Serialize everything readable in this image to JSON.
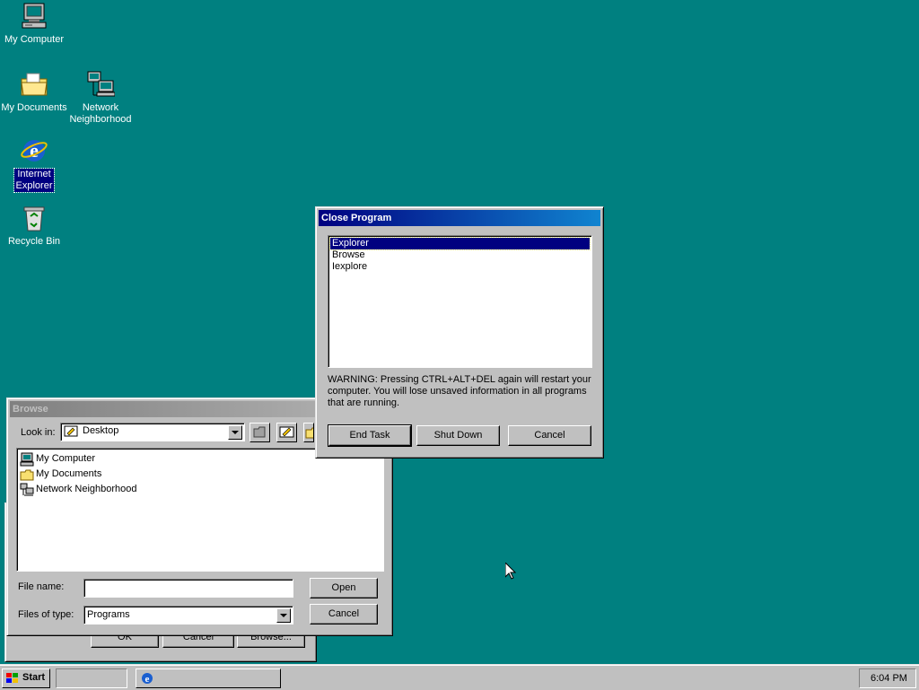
{
  "desktop": {
    "icons": [
      {
        "label": "My Computer",
        "icon": "my-computer-icon"
      },
      {
        "label": "My Documents",
        "icon": "my-documents-icon"
      },
      {
        "label": "Network Neighborhood",
        "icon": "network-neighborhood-icon"
      },
      {
        "label": "Internet Explorer",
        "icon": "internet-explorer-icon",
        "selected": true
      },
      {
        "label": "Recycle Bin",
        "icon": "recycle-bin-icon"
      }
    ],
    "background_color": "#008080"
  },
  "back_window": {
    "buttons": [
      "OK",
      "Cancel",
      "Browse..."
    ]
  },
  "browse_dialog": {
    "title": "Browse",
    "look_in_label": "Look in:",
    "look_in_value": "Desktop",
    "items": [
      "My Computer",
      "My Documents",
      "Network Neighborhood"
    ],
    "file_name_label": "File name:",
    "file_name_value": "",
    "files_of_type_label": "Files of type:",
    "files_of_type_value": "Programs",
    "open_button": "Open",
    "cancel_button": "Cancel"
  },
  "close_program": {
    "title": "Close Program",
    "tasks": [
      "Explorer",
      "Browse",
      "Iexplore"
    ],
    "selected_task": "Explorer",
    "warning": "WARNING: Pressing CTRL+ALT+DEL again will restart your computer. You will lose unsaved information in all programs that are running.",
    "end_task_button": "End Task",
    "shut_down_button": "Shut Down",
    "cancel_button": "Cancel"
  },
  "taskbar": {
    "start_label": "Start",
    "clock": "6:04 PM"
  }
}
